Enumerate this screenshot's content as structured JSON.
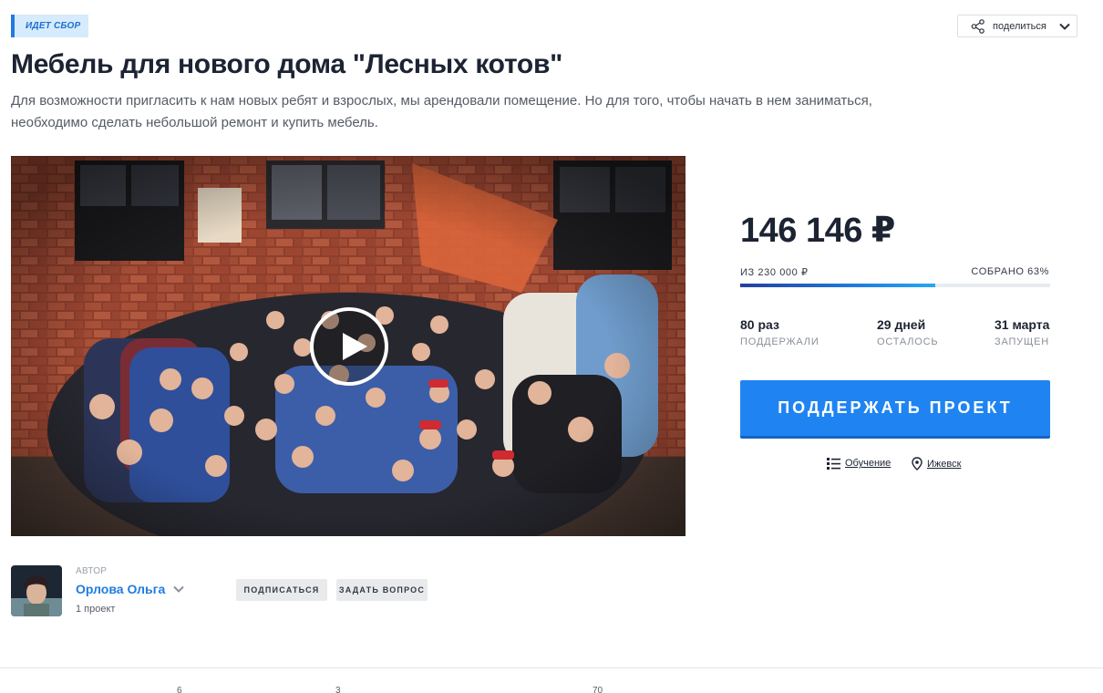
{
  "status_badge": "ИДЕТ СБОР",
  "share": {
    "label": "поделиться"
  },
  "project": {
    "title": "Мебель для нового дома \"Лесных котов\"",
    "description": "Для возможности пригласить к нам новых ребят и взрослых, мы арендовали помещение. Но для того, чтобы начать в нем заниматься, необходимо сделать небольшой ремонт и купить мебель."
  },
  "funding": {
    "amount": "146 146 ₽",
    "goal_label": "ИЗ 230 000 ₽",
    "collected_label": "СОБРАНО 63%",
    "progress_percent": 63
  },
  "stats": [
    {
      "value": "80 раз",
      "label": "ПОДДЕРЖАЛИ"
    },
    {
      "value": "29 дней",
      "label": "ОСТАЛОСЬ"
    },
    {
      "value": "31 марта",
      "label": "ЗАПУЩЕН"
    }
  ],
  "support_button": "ПОДДЕРЖАТЬ ПРОЕКТ",
  "meta": {
    "category": "Обучение",
    "location": "Ижевск"
  },
  "author": {
    "caption": "АВТОР",
    "name": "Орлова Ольга",
    "projects": "1 проект",
    "subscribe_label": "ПОДПИСАТЬСЯ",
    "ask_label": "ЗАДАТЬ ВОПРОС"
  },
  "tab_counts": [
    "6",
    "3",
    "70"
  ],
  "colors": {
    "accent": "#1f84f2",
    "badge_bg": "#d6ebfb",
    "title": "#1c2333",
    "link_blue": "#1f7ce0"
  },
  "icons": [
    "share-icon",
    "chevron-down-icon",
    "play-icon",
    "list-icon",
    "map-pin-icon"
  ]
}
